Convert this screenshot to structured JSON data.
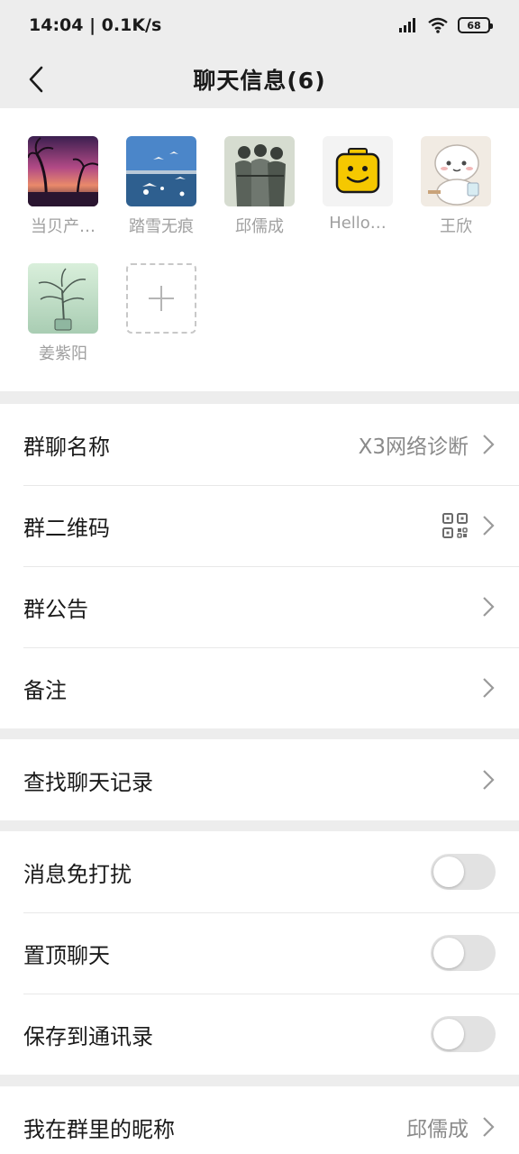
{
  "status_bar": {
    "time": "14:04",
    "speed": "0.1K/s",
    "battery": "68"
  },
  "header": {
    "title": "聊天信息(6)"
  },
  "members": [
    {
      "name": "当贝产…"
    },
    {
      "name": "踏雪无痕"
    },
    {
      "name": "邱儒成"
    },
    {
      "name": "Hello…"
    },
    {
      "name": "王欣"
    },
    {
      "name": "姜紫阳"
    }
  ],
  "info_group": {
    "group_name_label": "群聊名称",
    "group_name_value": "X3网络诊断",
    "qr_label": "群二维码",
    "announcement_label": "群公告",
    "remark_label": "备注"
  },
  "search_group": {
    "search_label": "查找聊天记录"
  },
  "toggle_group": {
    "mute_label": "消息免打扰",
    "mute_on": false,
    "pin_label": "置顶聊天",
    "pin_on": false,
    "save_label": "保存到通讯录",
    "save_on": false
  },
  "nickname_group": {
    "label": "我在群里的昵称",
    "value": "邱儒成"
  }
}
